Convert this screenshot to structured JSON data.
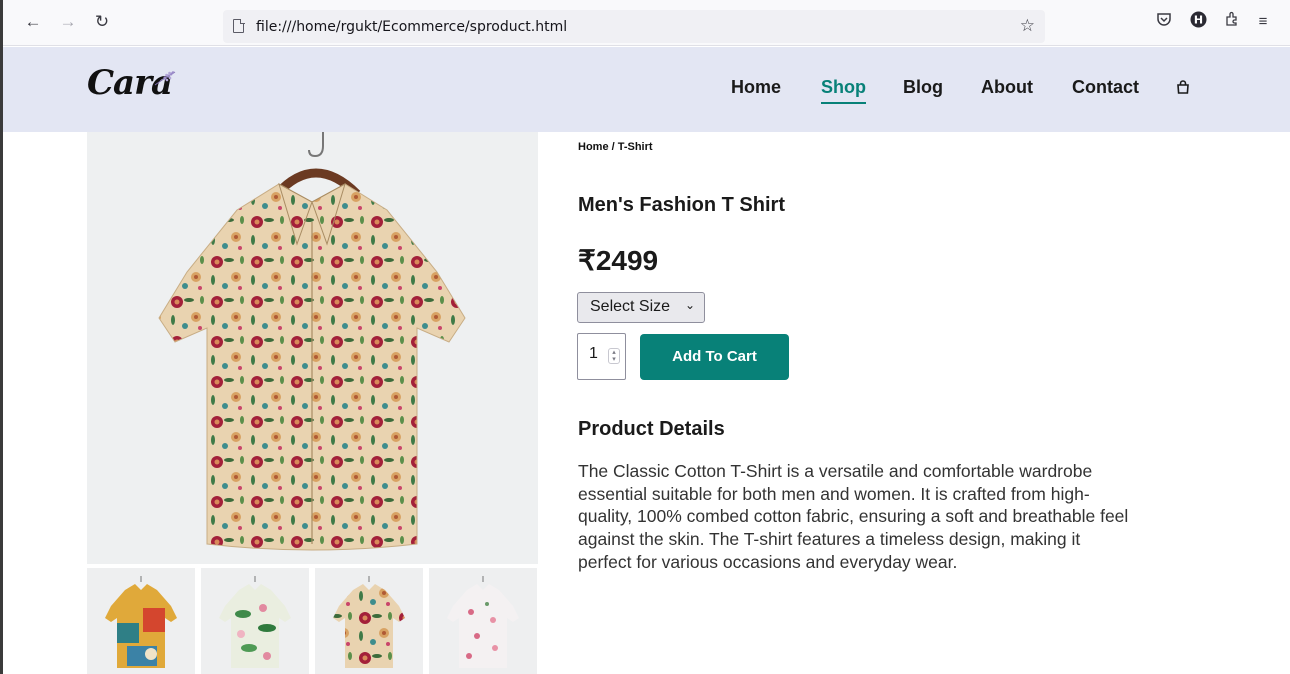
{
  "browser": {
    "url": "file:///home/rgukt/Ecommerce/sproduct.html",
    "back_icon": "arrow-left-icon",
    "forward_icon": "arrow-right-icon",
    "reload_icon": "reload-icon",
    "bookmark_icon": "star-icon"
  },
  "site": {
    "logo_text": "Cara",
    "nav": [
      {
        "label": "Home"
      },
      {
        "label": "Shop"
      },
      {
        "label": "Blog"
      },
      {
        "label": "About"
      },
      {
        "label": "Contact"
      }
    ],
    "bag_icon": "shopping-bag-icon",
    "accent_color": "#088178",
    "header_bg": "#e3e6f3"
  },
  "product": {
    "breadcrumb": "Home / T-Shirt",
    "title": "Men's Fashion T Shirt",
    "price": "₹2499",
    "size_select": "Select Size",
    "quantity": "1",
    "add_to_cart": "Add To Cart",
    "details_heading": "Product Details",
    "description": "The Classic Cotton T-Shirt is a versatile and comfortable wardrobe essential suitable for both men and women. It is crafted from high-quality, 100% combed cotton fabric, ensuring a soft and breathable feel against the skin. The T-shirt features a timeless design, making it perfect for various occasions and everyday wear."
  }
}
